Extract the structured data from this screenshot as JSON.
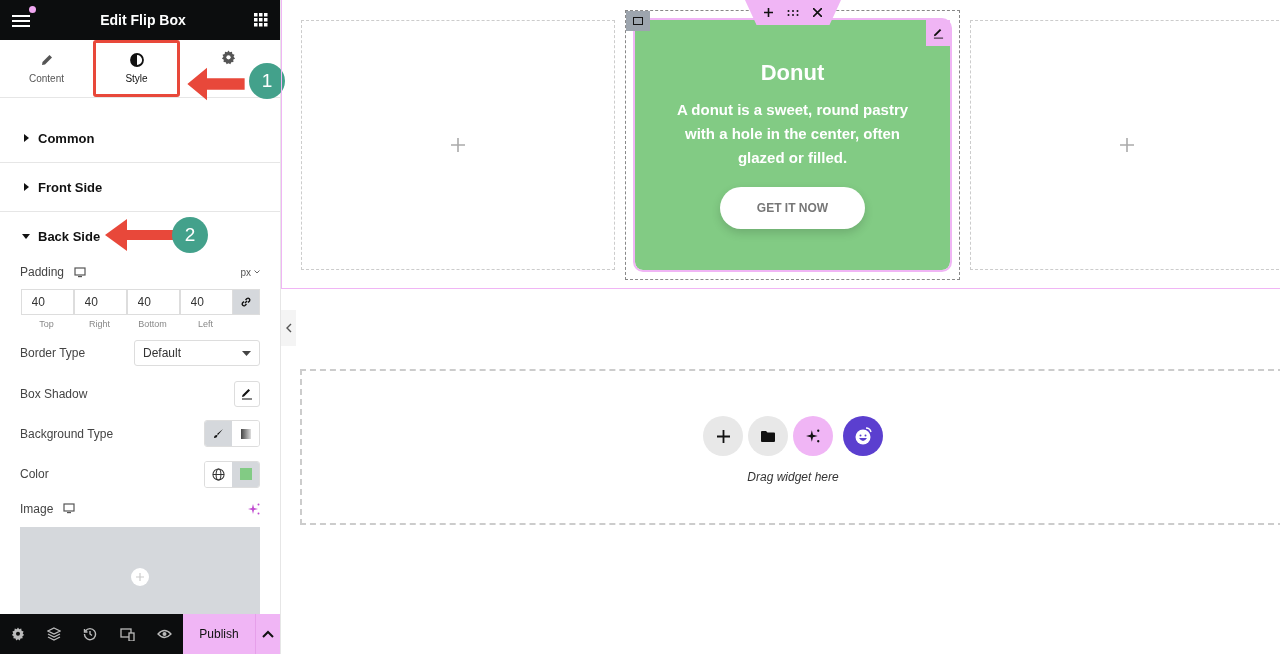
{
  "panel": {
    "title": "Edit Flip Box",
    "notification": true
  },
  "tabs": [
    {
      "label": "Content",
      "kind": "pencil",
      "selected": false,
      "highlighted": false
    },
    {
      "label": "Style",
      "kind": "contrast",
      "selected": true,
      "highlighted": true
    },
    {
      "kind": "gear",
      "selected": false,
      "highlighted": false
    }
  ],
  "callouts": [
    {
      "number": "1"
    },
    {
      "number": "2"
    }
  ],
  "sections": [
    {
      "label": "Common",
      "expanded": false
    },
    {
      "label": "Front Side",
      "expanded": false
    },
    {
      "label": "Back Side",
      "expanded": true
    }
  ],
  "padding": {
    "label": "Padding",
    "unit": "px",
    "linked": true,
    "fields": [
      {
        "value": "40",
        "caption": "Top"
      },
      {
        "value": "40",
        "caption": "Right"
      },
      {
        "value": "40",
        "caption": "Bottom"
      },
      {
        "value": "40",
        "caption": "Left"
      }
    ]
  },
  "border_type": {
    "label": "Border Type",
    "value": "Default"
  },
  "box_shadow": {
    "label": "Box Shadow"
  },
  "background_type": {
    "label": "Background Type",
    "options": [
      {
        "kind": "classic",
        "selected": true
      },
      {
        "kind": "gradient",
        "selected": false
      }
    ]
  },
  "color": {
    "label": "Color",
    "color": "#82cb84"
  },
  "image": {
    "label": "Image"
  },
  "footer": {
    "publish": "Publish"
  },
  "flip_box": {
    "title": "Donut",
    "text": "A donut is a sweet, round pastry with a hole in the center, often glazed or filled.",
    "button": "GET IT NOW",
    "color": "#82cb84"
  },
  "drop_zone": {
    "hint": "Drag widget here"
  }
}
